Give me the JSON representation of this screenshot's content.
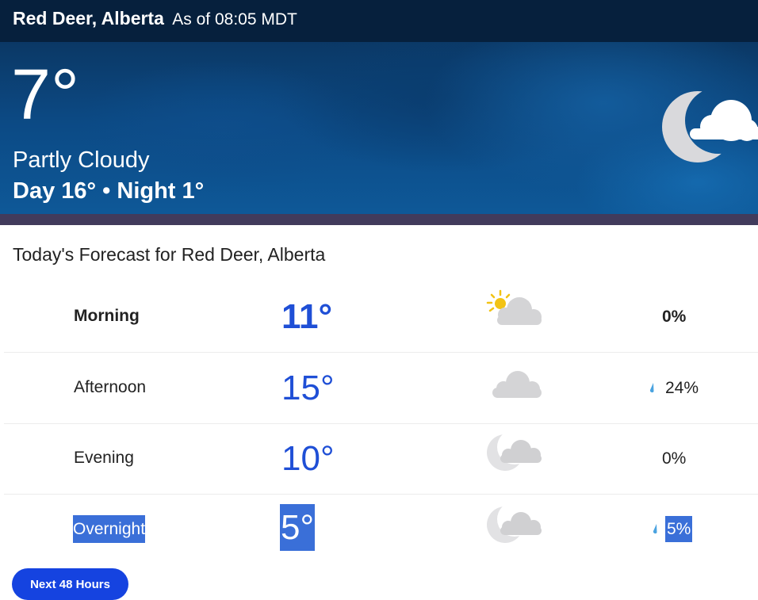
{
  "header": {
    "location": "Red Deer, Alberta",
    "as_of": "As of 08:05 MDT"
  },
  "current": {
    "temperature": "7°",
    "condition": "Partly Cloudy",
    "day_night": "Day 16° • Night 1°",
    "icon": "moon-cloud-icon"
  },
  "forecast": {
    "title": "Today's Forecast for Red Deer, Alberta",
    "rows": [
      {
        "period": "Morning",
        "temp": "11°",
        "icon": "sun-cloud-icon",
        "precip": "0%",
        "rain_drop": false
      },
      {
        "period": "Afternoon",
        "temp": "15°",
        "icon": "cloud-icon",
        "precip": "24%",
        "rain_drop": true
      },
      {
        "period": "Evening",
        "temp": "10°",
        "icon": "moon-cloud-icon",
        "precip": "0%",
        "rain_drop": false
      },
      {
        "period": "Overnight",
        "temp": "5°",
        "icon": "moon-cloud-icon",
        "precip": "5%",
        "rain_drop": true
      }
    ]
  },
  "buttons": {
    "next_48_hours": "Next 48 Hours"
  },
  "colors": {
    "temp_blue": "#1f4fd6",
    "button_blue": "#1543e0",
    "selection_blue": "#3a6fd8",
    "raindrop_blue": "#4aa3e0"
  }
}
